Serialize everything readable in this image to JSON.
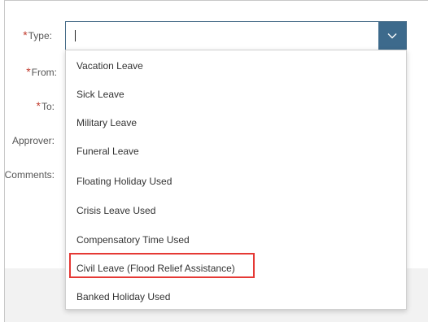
{
  "form": {
    "type_label": "Type:",
    "from_label": "From:",
    "to_label": "To:",
    "approver_label": "Approver:",
    "comments_label": "Comments:",
    "required_marker": "*",
    "type_value": ""
  },
  "dropdown": {
    "toggle_icon": "chevron-down-icon",
    "options": [
      "Vacation Leave",
      "Sick Leave",
      "Military Leave",
      "Funeral Leave",
      "Floating Holiday Used",
      "Crisis Leave Used",
      "Compensatory Time Used",
      "Civil Leave (Flood Relief Assistance)",
      "Banked Holiday Used"
    ],
    "highlighted_option": "Civil Leave (Flood Relief Assistance)"
  },
  "colors": {
    "accent": "#3d6a8c",
    "required": "#c0392b",
    "highlight_border": "#e53935"
  }
}
